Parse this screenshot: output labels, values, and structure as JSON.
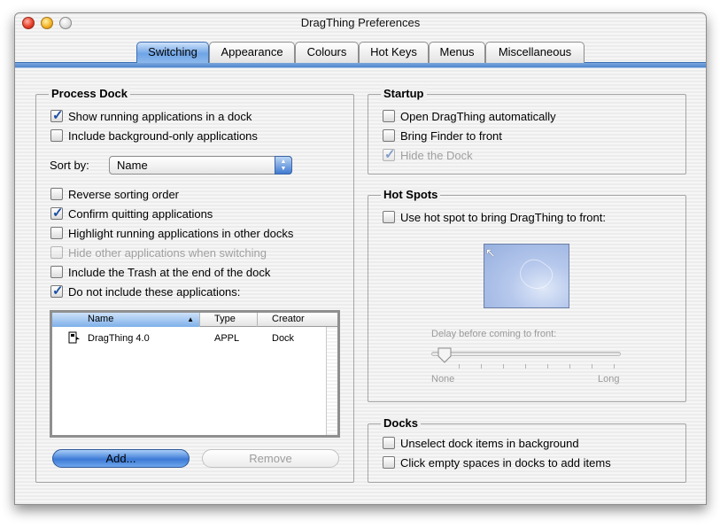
{
  "window": {
    "title": "DragThing Preferences"
  },
  "tabs": [
    {
      "label": "Switching",
      "selected": true
    },
    {
      "label": "Appearance",
      "selected": false
    },
    {
      "label": "Colours",
      "selected": false
    },
    {
      "label": "Hot Keys",
      "selected": false
    },
    {
      "label": "Menus",
      "selected": false
    },
    {
      "label": "Miscellaneous",
      "selected": false
    }
  ],
  "process_dock": {
    "title": "Process Dock",
    "show_running": {
      "label": "Show running applications in a dock",
      "checked": true
    },
    "include_background": {
      "label": "Include background-only applications",
      "checked": false
    },
    "sort_by_label": "Sort by:",
    "sort_by_value": "Name",
    "reverse_sorting": {
      "label": "Reverse sorting order",
      "checked": false
    },
    "confirm_quitting": {
      "label": "Confirm quitting applications",
      "checked": true
    },
    "highlight_running": {
      "label": "Highlight running applications in other docks",
      "checked": false
    },
    "hide_other": {
      "label": "Hide other applications when switching",
      "checked": false,
      "disabled": true
    },
    "include_trash": {
      "label": "Include the Trash at the end of the dock",
      "checked": false
    },
    "do_not_include": {
      "label": "Do not include these applications:",
      "checked": true
    },
    "list": {
      "columns": [
        "Name",
        "Type",
        "Creator"
      ],
      "rows": [
        {
          "name": "DragThing 4.0",
          "type": "APPL",
          "creator": "Dock"
        }
      ]
    },
    "add_button": "Add...",
    "remove_button": "Remove"
  },
  "startup": {
    "title": "Startup",
    "open_auto": {
      "label": "Open DragThing automatically",
      "checked": false
    },
    "bring_finder": {
      "label": "Bring Finder to front",
      "checked": false
    },
    "hide_dock": {
      "label": "Hide the Dock",
      "checked": true,
      "disabled": true
    }
  },
  "hot_spots": {
    "title": "Hot Spots",
    "use_hot_spot": {
      "label": "Use hot spot to bring DragThing to front:",
      "checked": false
    },
    "delay_label": "Delay before coming to front:",
    "slider_min_label": "None",
    "slider_max_label": "Long",
    "slider_value_fraction": 0.0
  },
  "docks": {
    "title": "Docks",
    "unselect": {
      "label": "Unselect dock items in background",
      "checked": false
    },
    "click_empty": {
      "label": "Click empty spaces in docks to add items",
      "checked": false
    }
  },
  "colors": {
    "accent": "#5a8fd8",
    "disabled_text": "#a0a0a0"
  },
  "icons": {
    "close": "close-icon",
    "minimize": "minimize-icon",
    "zoom": "zoom-icon",
    "app": "application-icon",
    "sort": "sort-ascending-icon",
    "popup": "popup-arrows-icon",
    "hotspot_cursor": "arrow-cursor-icon"
  }
}
